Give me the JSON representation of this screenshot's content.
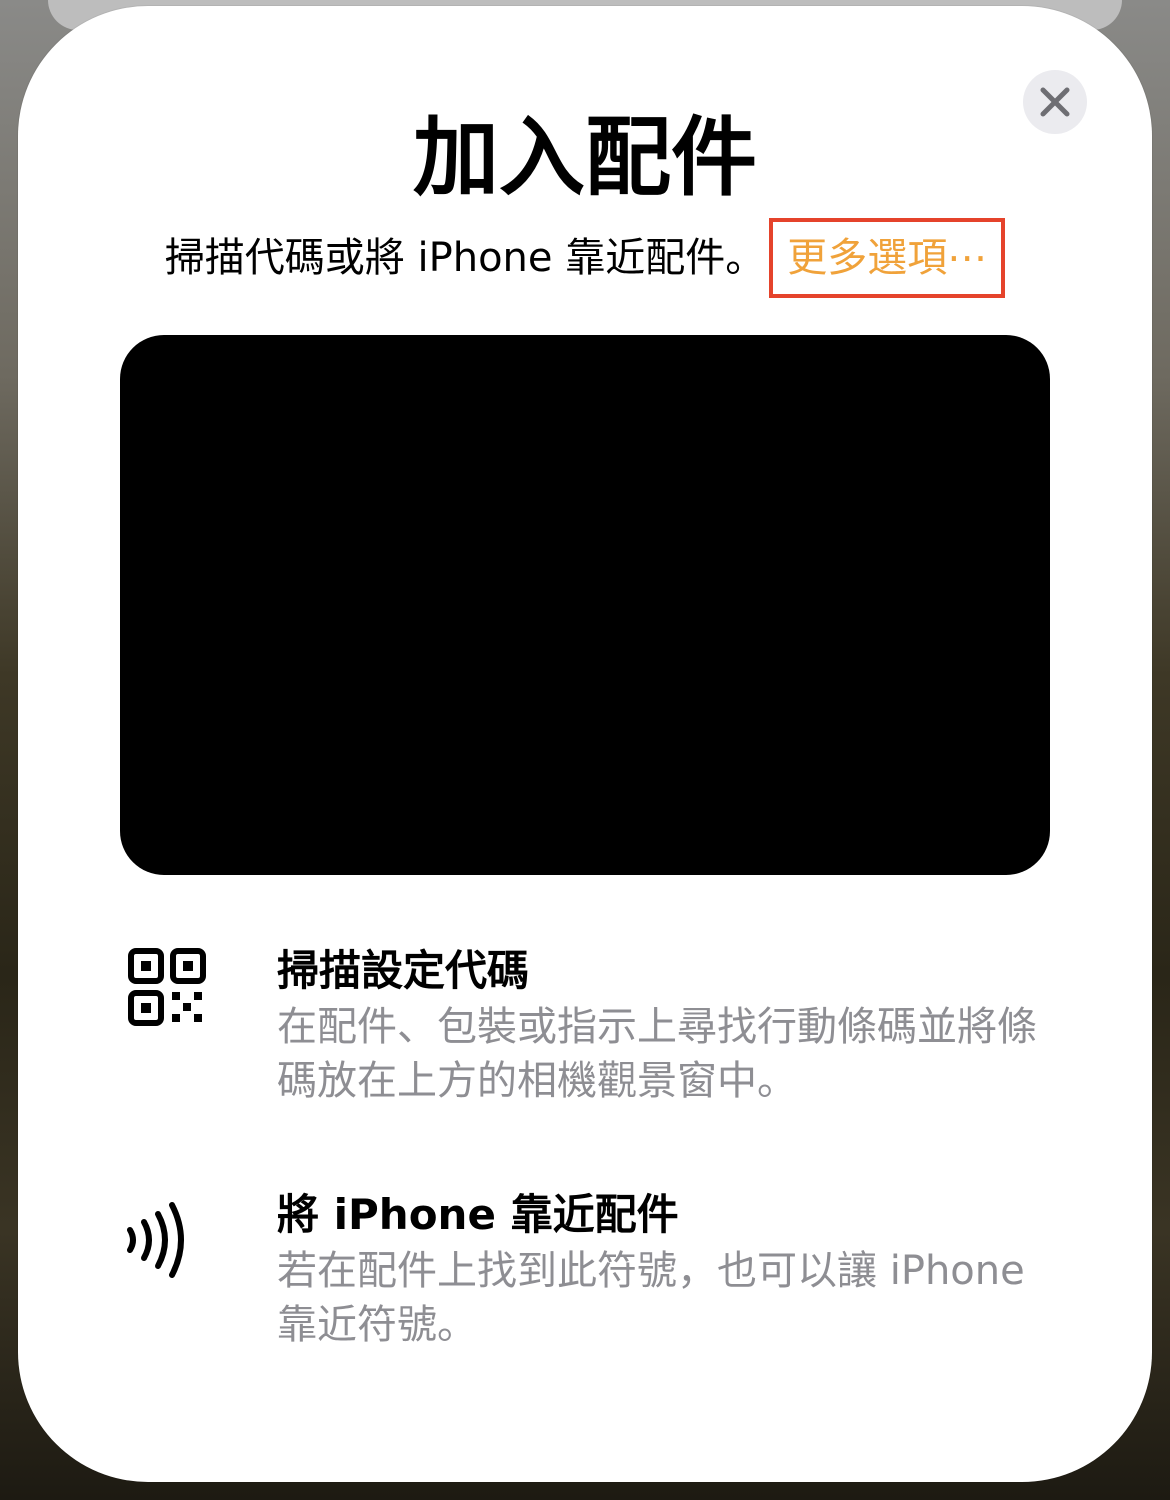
{
  "sheet": {
    "title": "加入配件",
    "subtitle": "掃描代碼或將 iPhone 靠近配件。",
    "more_options_label": "更多選項⋯",
    "close_icon": "xmark-icon"
  },
  "instructions": [
    {
      "icon": "qr-code-icon",
      "title": "掃描設定代碼",
      "description": "在配件、包裝或指示上尋找行動條碼並將條碼放在上方的相機觀景窗中。"
    },
    {
      "icon": "nfc-wave-icon",
      "title": "將 iPhone 靠近配件",
      "description": "若在配件上找到此符號，也可以讓 iPhone 靠近符號。"
    }
  ],
  "colors": {
    "accent": "#f0a23a",
    "highlight_border": "#e5432b",
    "secondary_text": "#8e8e93",
    "close_button_bg": "#ebebef"
  }
}
